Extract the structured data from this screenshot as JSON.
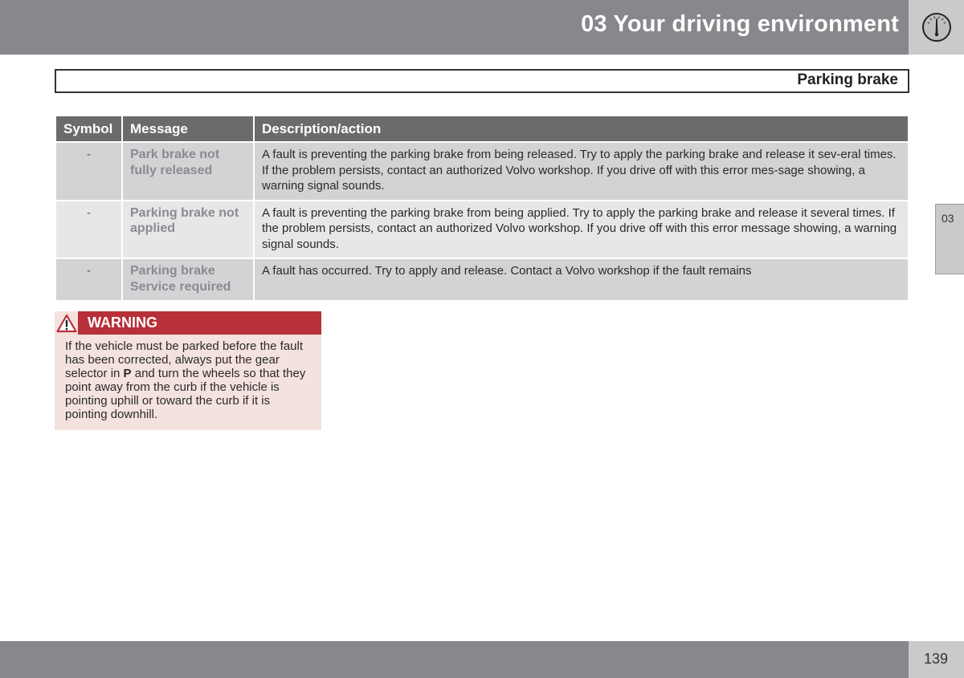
{
  "header": {
    "chapter_title": "03 Your driving environment",
    "icon": "speedometer-gauge-icon"
  },
  "section": {
    "title": "Parking brake"
  },
  "table": {
    "columns": [
      "Symbol",
      "Message",
      "Description/action"
    ],
    "rows": [
      {
        "symbol": "-",
        "message": "Park brake not fully released",
        "description": "A fault is preventing the parking brake from being released. Try to apply the parking brake and release it sev-eral times. If the problem persists, contact an authorized Volvo workshop. If you drive off with this error mes-sage showing, a warning signal sounds."
      },
      {
        "symbol": "-",
        "message": "Parking brake not applied",
        "description": "A fault is preventing the parking brake from being applied. Try to apply the parking brake and release it several times. If the problem persists, contact an authorized Volvo workshop. If you drive off with this error message showing, a warning signal sounds."
      },
      {
        "symbol": "-",
        "message": "Parking brake Service required",
        "description": "A fault has occurred. Try to apply and release. Contact a Volvo workshop if the fault remains"
      }
    ]
  },
  "side_tab": {
    "label": "03"
  },
  "warning": {
    "icon": "warning-triangle-icon",
    "title": "WARNING",
    "text_before": "If the vehicle must be parked before the fault has been corrected, always put the gear selector in ",
    "text_bold": "P",
    "text_after": " and turn the wheels so that they point away from the curb if the vehicle is pointing uphill or toward the curb if it is pointing downhill."
  },
  "footer": {
    "page_number": "139"
  },
  "colors": {
    "header_gray": "#87888c",
    "table_header": "#6a6b6d",
    "warning_red": "#b83038",
    "warning_bg": "#f4e2df"
  }
}
